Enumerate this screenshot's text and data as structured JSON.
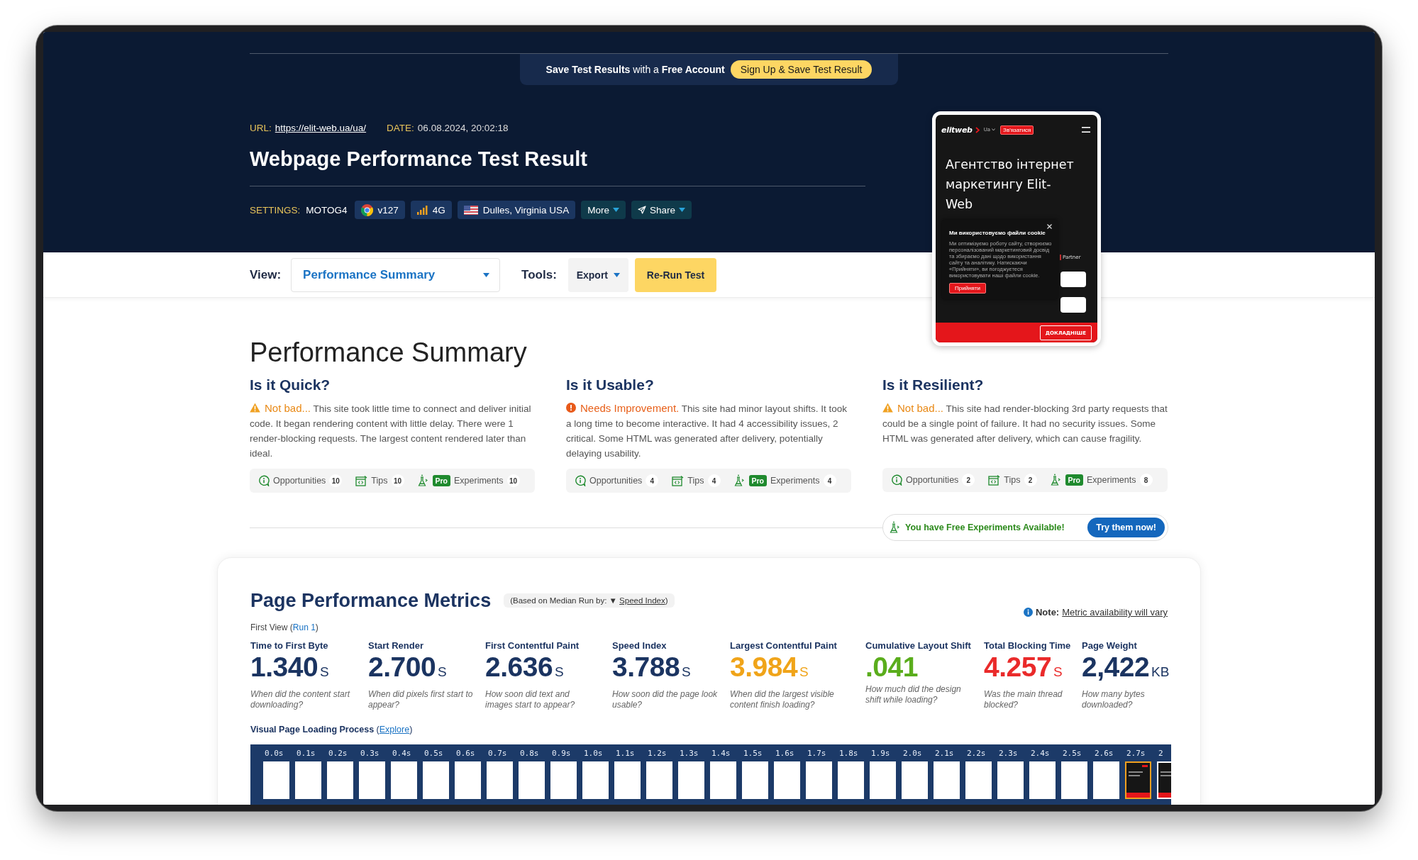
{
  "banner": {
    "text": "**Save Test Results** with a **Free Account**",
    "button": "Sign Up & Save Test Result"
  },
  "test": {
    "url_label": "URL:",
    "url": "https://elit-web.ua/ua/",
    "date_label": "DATE:",
    "date": "06.08.2024, 20:02:18",
    "title": "Webpage Performance Test Result"
  },
  "settings": {
    "label": "SETTINGS:",
    "device": "MOTOG4",
    "chips": [
      {
        "kind": "browser",
        "text": "v127"
      },
      {
        "kind": "connection",
        "text": "4G"
      },
      {
        "kind": "location",
        "text": "Dulles, Virginia USA"
      },
      {
        "kind": "menu",
        "text": "More"
      },
      {
        "kind": "share",
        "text": "Share"
      }
    ]
  },
  "toolbar": {
    "view_label": "View:",
    "view": "Performance Summary",
    "tools_label": "Tools:",
    "export": "Export",
    "rerun": "Re-Run Test"
  },
  "preview": {
    "logo": "elitweb",
    "language": "Ua",
    "contact": "Зв'язатися",
    "headline": "Агентство інтернет маркетингу Elit-Web",
    "partner": "Partner",
    "cta": "ДОКЛАДНІШЕ",
    "cookie": {
      "title": "Ми використовуємо файли cookie",
      "text": "Ми оптимізуємо роботу сайту, створюємо персоналізований маркетинговий досвід та збираємо дані щодо використання сайту та аналітику. Натискаючи «Прийняти», ви погоджуєтеся використовувати наші файли cookie.",
      "button": "Прийняти"
    }
  },
  "summary": {
    "title": "Performance Summary",
    "sections": [
      {
        "title": "Is it Quick?",
        "kind": "warning",
        "verdict": "Not bad...",
        "text": "This site took little time to connect and deliver initial code. It began rendering content with little delay. There were 1 render-blocking requests. The largest content rendered later than ideal.",
        "counters": [
          {
            "kind": "opportunities",
            "label": "Opportunities",
            "count": "10"
          },
          {
            "kind": "tips",
            "label": "Tips",
            "count": "10"
          },
          {
            "kind": "experiments",
            "badge": "Pro",
            "label": "Experiments",
            "count": "10"
          }
        ]
      },
      {
        "title": "Is it Usable?",
        "kind": "error",
        "verdict": "Needs Improvement.",
        "text": "This site had minor layout shifts. It took a long time to become interactive. It had 4 accessibility issues, 2 critical. Some HTML was generated after delivery, potentially delaying usability.",
        "counters": [
          {
            "kind": "opportunities",
            "label": "Opportunities",
            "count": "4"
          },
          {
            "kind": "tips",
            "label": "Tips",
            "count": "4"
          },
          {
            "kind": "experiments",
            "badge": "Pro",
            "label": "Experiments",
            "count": "4"
          }
        ]
      },
      {
        "title": "Is it Resilient?",
        "kind": "warning",
        "verdict": "Not bad...",
        "text": "This site had render-blocking 3rd party requests that could be a single point of failure. It had no security issues. Some HTML was generated after delivery, which can cause fragility.",
        "counters": [
          {
            "kind": "opportunities",
            "label": "Opportunities",
            "count": "2"
          },
          {
            "kind": "tips",
            "label": "Tips",
            "count": "2"
          },
          {
            "kind": "experiments",
            "badge": "Pro",
            "label": "Experiments",
            "count": "8"
          }
        ]
      }
    ],
    "promo": {
      "text": "You have Free Experiments Available!",
      "button": "Try them now!"
    }
  },
  "metrics": {
    "title": "Page Performance Metrics",
    "median": {
      "before": "(Based on Median Run by: ▼ ",
      "link": "Speed Index",
      "after": ")"
    },
    "note": {
      "label": "Note:",
      "link": "Metric availability will vary"
    },
    "first_view": {
      "before": "First View (",
      "link": "Run 1",
      "after": ")"
    },
    "items": [
      {
        "label": "Time to First Byte",
        "value": "1.340",
        "unit": "S",
        "color": "#1b3461",
        "hint": "When did the content start downloading?"
      },
      {
        "label": "Start Render",
        "value": "2.700",
        "unit": "S",
        "color": "#1b3461",
        "hint": "When did pixels first start to appear?"
      },
      {
        "label": "First Contentful Paint",
        "value": "2.636",
        "unit": "S",
        "color": "#1b3461",
        "hint": "How soon did text and images start to appear?"
      },
      {
        "label": "Speed Index",
        "value": "3.788",
        "unit": "S",
        "color": "#1b3461",
        "hint": "How soon did the page look usable?"
      },
      {
        "label": "Largest Contentful Paint",
        "value": "3.984",
        "unit": "S",
        "color": "#f0a419",
        "hint": "When did the largest visible content finish loading?"
      },
      {
        "label": "Cumulative Layout Shift",
        "value": ".041",
        "color": "#5aad1c",
        "hint": "How much did the design shift while loading?"
      },
      {
        "label": "Total Blocking Time",
        "value": "4.257",
        "unit": "S",
        "color": "#ea2a2a",
        "hint": "Was the main thread blocked?"
      },
      {
        "label": "Page Weight",
        "value": "2,422",
        "unit": "KB",
        "color": "#1b3461",
        "hint": "How many bytes downloaded?"
      }
    ]
  },
  "filmstrip": {
    "before": "**Visual Page Loading Process** (",
    "link": "Explore",
    "after": ")",
    "frames": [
      {
        "time": "0.0s",
        "kind": "blank",
        "selected": false
      },
      {
        "time": "0.1s",
        "kind": "blank",
        "selected": false
      },
      {
        "time": "0.2s",
        "kind": "blank",
        "selected": false
      },
      {
        "time": "0.3s",
        "kind": "blank",
        "selected": false
      },
      {
        "time": "0.4s",
        "kind": "blank",
        "selected": false
      },
      {
        "time": "0.5s",
        "kind": "blank",
        "selected": false
      },
      {
        "time": "0.6s",
        "kind": "blank",
        "selected": false
      },
      {
        "time": "0.7s",
        "kind": "blank",
        "selected": false
      },
      {
        "time": "0.8s",
        "kind": "blank",
        "selected": false
      },
      {
        "time": "0.9s",
        "kind": "blank",
        "selected": false
      },
      {
        "time": "1.0s",
        "kind": "blank",
        "selected": false
      },
      {
        "time": "1.1s",
        "kind": "blank",
        "selected": false
      },
      {
        "time": "1.2s",
        "kind": "blank",
        "selected": false
      },
      {
        "time": "1.3s",
        "kind": "blank",
        "selected": false
      },
      {
        "time": "1.4s",
        "kind": "blank",
        "selected": false
      },
      {
        "time": "1.5s",
        "kind": "blank",
        "selected": false
      },
      {
        "time": "1.6s",
        "kind": "blank",
        "selected": false
      },
      {
        "time": "1.7s",
        "kind": "blank",
        "selected": false
      },
      {
        "time": "1.8s",
        "kind": "blank",
        "selected": false
      },
      {
        "time": "1.9s",
        "kind": "blank",
        "selected": false
      },
      {
        "time": "2.0s",
        "kind": "blank",
        "selected": false
      },
      {
        "time": "2.1s",
        "kind": "blank",
        "selected": false
      },
      {
        "time": "2.2s",
        "kind": "blank",
        "selected": false
      },
      {
        "time": "2.3s",
        "kind": "blank",
        "selected": false
      },
      {
        "time": "2.4s",
        "kind": "blank",
        "selected": false
      },
      {
        "time": "2.5s",
        "kind": "blank",
        "selected": false
      },
      {
        "time": "2.6s",
        "kind": "blank",
        "selected": false
      },
      {
        "time": "2.7s",
        "kind": "rendered",
        "selected": true
      },
      {
        "time": "2",
        "kind": "rendered",
        "selected": false
      }
    ]
  }
}
